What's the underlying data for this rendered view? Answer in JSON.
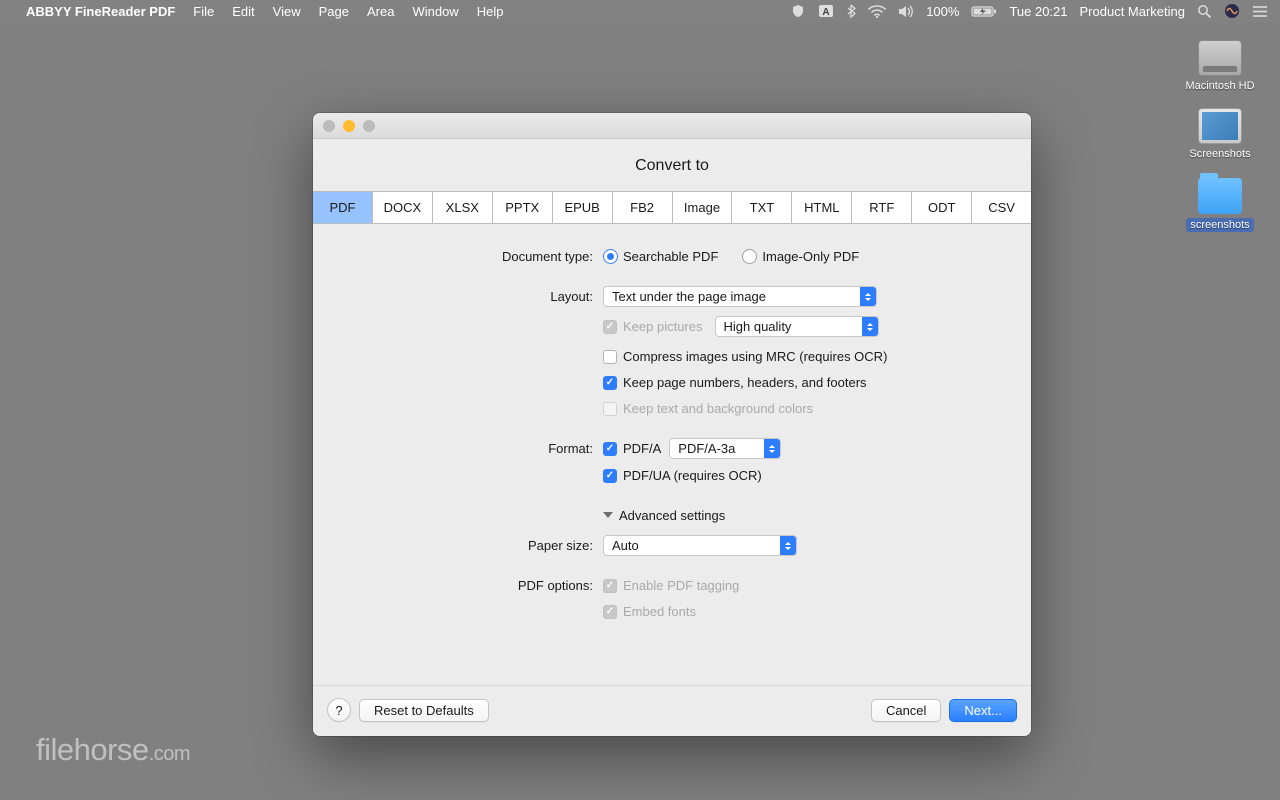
{
  "menubar": {
    "app": "ABBYY FineReader PDF",
    "items": [
      "File",
      "Edit",
      "View",
      "Page",
      "Area",
      "Window",
      "Help"
    ],
    "battery": "100%",
    "clock": "Tue 20:21",
    "user": "Product Marketing"
  },
  "desktop": {
    "hd": "Macintosh HD",
    "screenshots": "Screenshots",
    "folder": "screenshots"
  },
  "dialog": {
    "title": "Convert to",
    "tabs": [
      "PDF",
      "DOCX",
      "XLSX",
      "PPTX",
      "EPUB",
      "FB2",
      "Image",
      "TXT",
      "HTML",
      "RTF",
      "ODT",
      "CSV"
    ],
    "labels": {
      "doctype": "Document type:",
      "layout": "Layout:",
      "format": "Format:",
      "papersize": "Paper size:",
      "pdfoptions": "PDF options:"
    },
    "radios": {
      "searchable": "Searchable PDF",
      "imageonly": "Image-Only PDF"
    },
    "selects": {
      "layout": "Text under the page image",
      "quality": "High quality",
      "pdfa": "PDF/A-3a",
      "paper": "Auto"
    },
    "checks": {
      "keeppics": "Keep pictures",
      "compress": "Compress images using MRC (requires OCR)",
      "keeppagenum": "Keep page numbers, headers, and footers",
      "keepcolors": "Keep text and background colors",
      "pdfa": "PDF/A",
      "pdfua": "PDF/UA (requires OCR)",
      "advanced": "Advanced settings",
      "tagging": "Enable PDF tagging",
      "embed": "Embed fonts"
    },
    "buttons": {
      "help": "?",
      "reset": "Reset to Defaults",
      "cancel": "Cancel",
      "next": "Next..."
    }
  },
  "watermark": {
    "a": "filehorse",
    "b": ".com"
  }
}
